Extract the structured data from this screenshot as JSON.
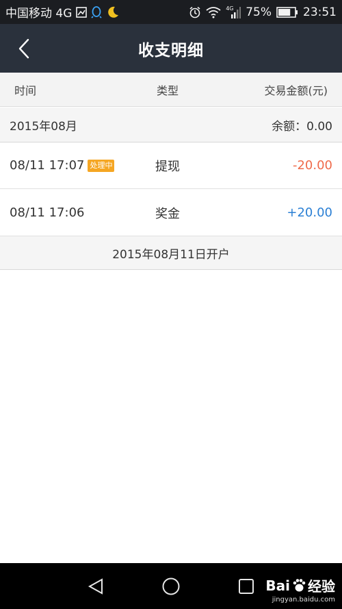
{
  "status_bar": {
    "carrier": "中国移动 4G",
    "battery_percent": "75%",
    "time": "23:51",
    "signal_label": "4G",
    "battery_level": 0.75
  },
  "header": {
    "title": "收支明细"
  },
  "columns": {
    "time": "时间",
    "type": "类型",
    "amount": "交易金额(元)"
  },
  "month": {
    "label": "2015年08月",
    "balance": "余额：0.00"
  },
  "transactions": [
    {
      "time": "08/11 17:07",
      "badge": "处理中",
      "type": "提现",
      "amount": "-20.00"
    },
    {
      "time": "08/11 17:06",
      "badge": "",
      "type": "奖金",
      "amount": "+20.00"
    }
  ],
  "account_open": "2015年08月11日开户",
  "watermark": {
    "brand_left": "Bai",
    "brand_right": "经验",
    "url": "jingyan.baidu.com"
  },
  "colors": {
    "header_bg": "#2a313c",
    "negative": "#ef6a4a",
    "positive": "#2a7fd4",
    "badge": "#f5a623"
  }
}
